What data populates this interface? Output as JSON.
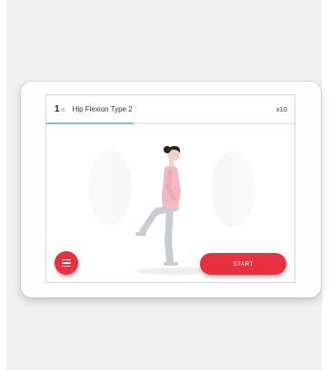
{
  "exercise": {
    "counter_current": "1",
    "counter_total": "/8",
    "title": "Hip Flexion Type 2",
    "reps": "x10",
    "progress_fraction": 0.35
  },
  "controls": {
    "menu_icon": "hamburger-menu-icon",
    "start_label": "START"
  },
  "colors": {
    "accent": "#e8303f",
    "progress": "#7ec4d6",
    "top": "#f4b9c0",
    "legs": "#c9cdd1",
    "hair": "#2a2222",
    "skin": "#f1d2c2"
  }
}
